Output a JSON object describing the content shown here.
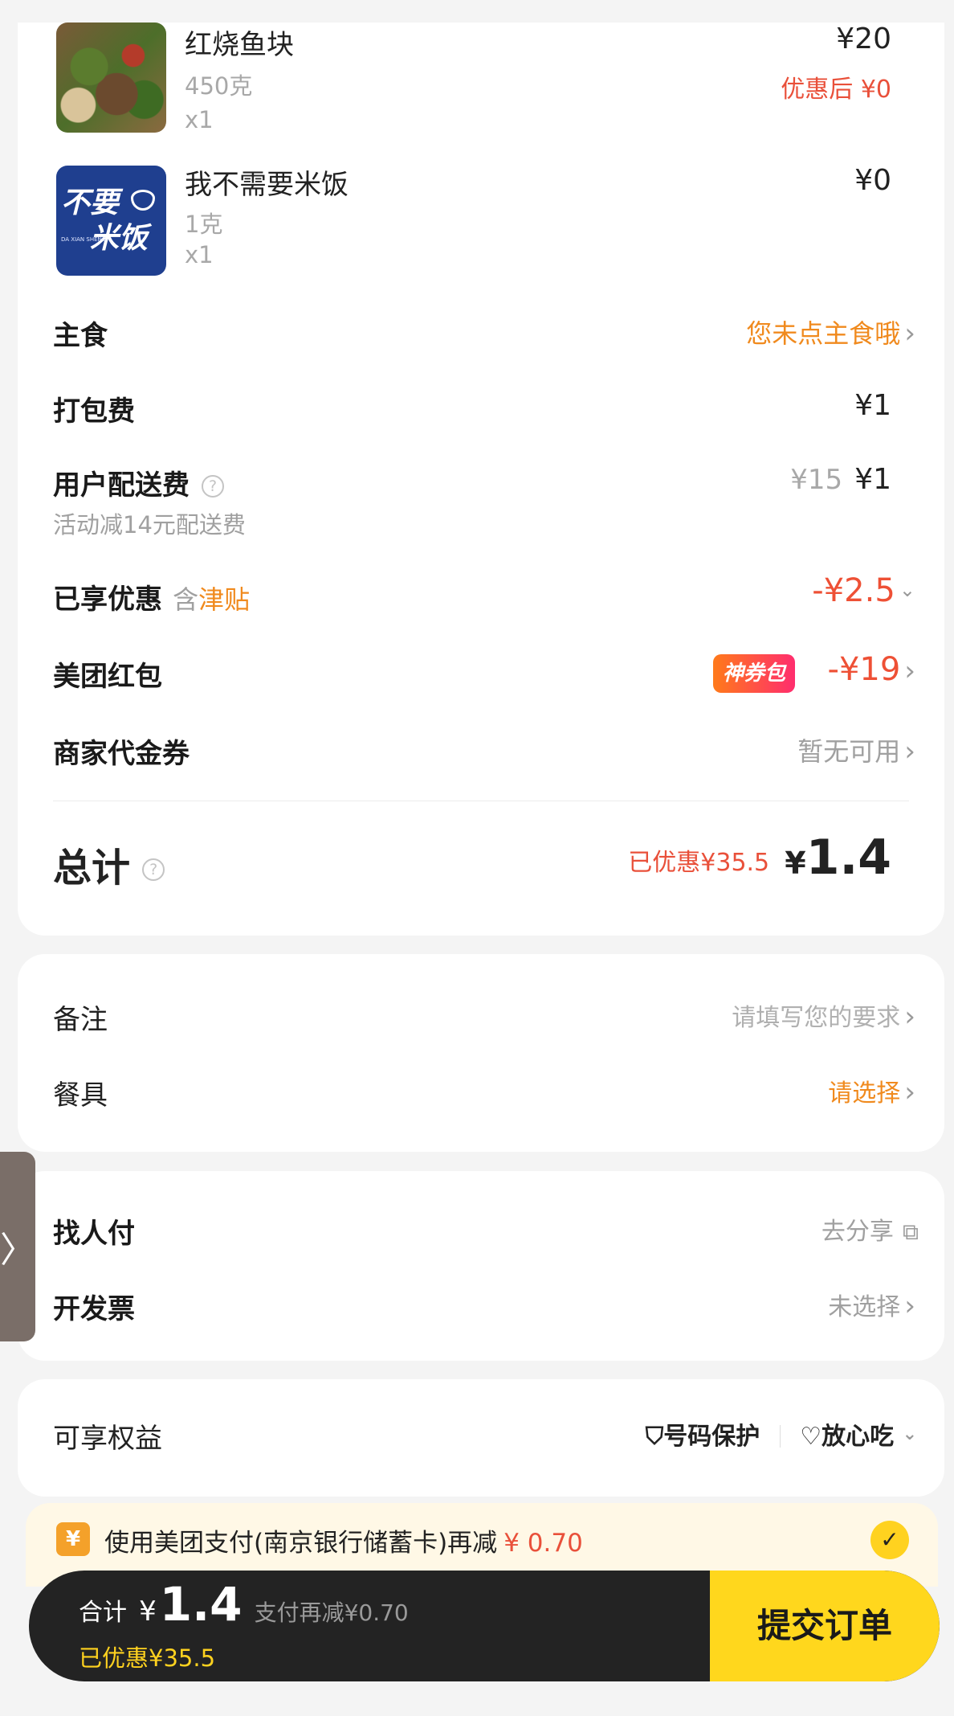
{
  "items": [
    {
      "name": "红烧鱼块",
      "spec": "450克",
      "qty": "x1",
      "price": "¥20",
      "discounted": "优惠后 ¥0"
    },
    {
      "name": "我不需要米饭",
      "spec": "1克",
      "qty": "x1",
      "price": "¥0",
      "logo_line1": "不要",
      "logo_line2": "米饭",
      "logo_small": "DA XIAN SHENG"
    }
  ],
  "staple": {
    "label": "主食",
    "value": "您未点主食哦"
  },
  "packing": {
    "label": "打包费",
    "value": "¥1"
  },
  "delivery": {
    "label": "用户配送费",
    "note": "活动减14元配送费",
    "original": "¥15",
    "value": "¥1"
  },
  "discount": {
    "label": "已享优惠",
    "prefix": "含",
    "subsidy": "津贴",
    "value": "-¥2.5"
  },
  "redpacket": {
    "label": "美团红包",
    "badge": "神券包",
    "value": "-¥19"
  },
  "voucher": {
    "label": "商家代金券",
    "value": "暂无可用"
  },
  "total": {
    "label": "总计",
    "saved": "已优惠¥35.5",
    "currency": "¥",
    "amount": "1.4"
  },
  "remark": {
    "label": "备注",
    "placeholder": "请填写您的要求"
  },
  "tableware": {
    "label": "餐具",
    "value": "请选择"
  },
  "pay_other": {
    "label": "找人付",
    "value": "去分享"
  },
  "invoice": {
    "label": "开发票",
    "value": "未选择"
  },
  "rights": {
    "label": "可享权益",
    "item1": "号码保护",
    "item2": "放心吃"
  },
  "pay_banner": {
    "text": "使用美团支付(南京银行储蓄卡)再减",
    "amount": "¥ 0.70"
  },
  "bottom": {
    "label": "合计",
    "currency": "¥",
    "amount": "1.4",
    "extra": "支付再减¥0.70",
    "saved": "已优惠¥35.5",
    "submit": "提交订单"
  },
  "colors": {
    "accent_orange": "#f08a1e",
    "price_red": "#e9503a",
    "brand_yellow": "#ffd71d",
    "bar_dark": "#232323"
  }
}
